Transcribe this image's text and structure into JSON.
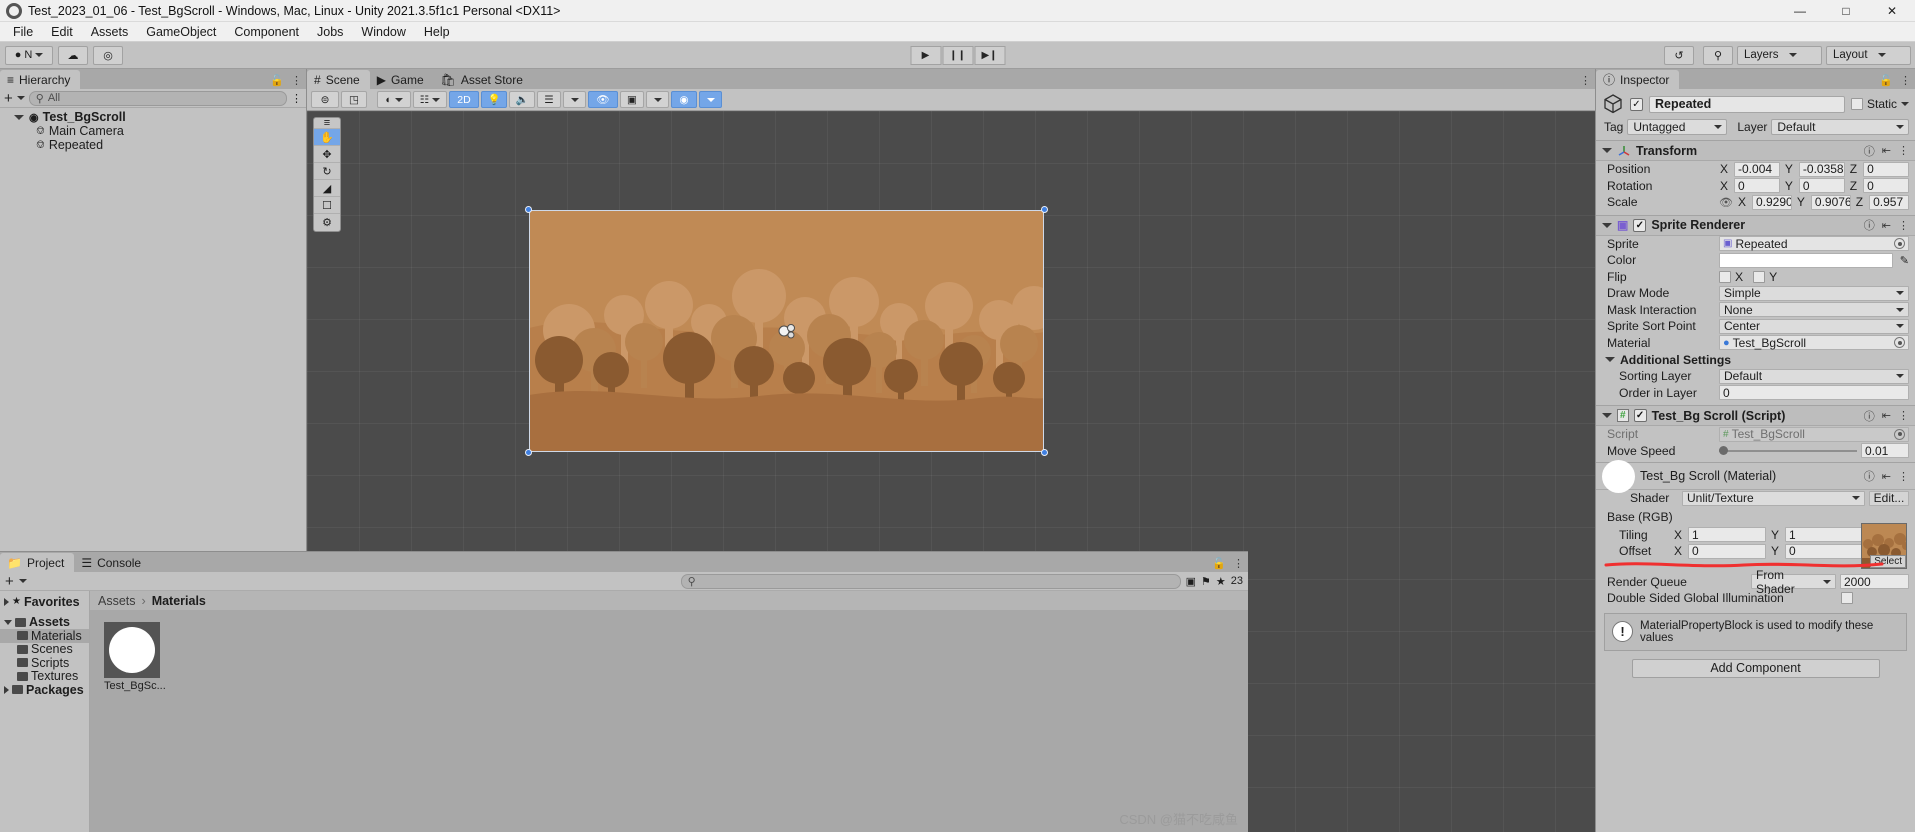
{
  "titlebar": {
    "title": "Test_2023_01_06 - Test_BgScroll - Windows, Mac, Linux - Unity 2021.3.5f1c1 Personal <DX11>",
    "minimize": "—",
    "maximize": "□",
    "close": "✕"
  },
  "menubar": {
    "items": [
      "File",
      "Edit",
      "Assets",
      "GameObject",
      "Component",
      "Jobs",
      "Window",
      "Help"
    ]
  },
  "toolbar": {
    "account": "N",
    "cloud": "☁",
    "services": "◎",
    "play": "▶",
    "pause": "❙❙",
    "step": "▶❙",
    "history": "↺",
    "search": "🔍",
    "layers_label": "Layers",
    "layout_label": "Layout"
  },
  "hierarchy": {
    "tab": "Hierarchy",
    "search_placeholder": "All",
    "items": [
      {
        "label": "Test_BgScroll",
        "level": 0,
        "icon": "unity-scene-icon"
      },
      {
        "label": "Main Camera",
        "level": 1,
        "icon": "gameobject-icon"
      },
      {
        "label": "Repeated",
        "level": 1,
        "icon": "gameobject-icon"
      }
    ]
  },
  "scene": {
    "tabs": [
      {
        "label": "Scene",
        "icon": "scene-icon",
        "active": true
      },
      {
        "label": "Game",
        "icon": "game-icon",
        "active": false
      },
      {
        "label": "Asset Store",
        "icon": "store-icon",
        "active": false
      }
    ],
    "toolbar": {
      "shading_mode": "Shaded",
      "twod_label": "2D",
      "buttons": [
        "pivot-icon",
        "local-icon",
        "shading-dropdown",
        "2d-toggle",
        "lighting-toggle",
        "audio-toggle",
        "fx-dropdown",
        "hidden-toggle",
        "camera-dropdown",
        "gizmos-dropdown"
      ]
    },
    "tools": [
      "hand-tool",
      "move-tool",
      "rotate-tool",
      "scale-tool",
      "rect-tool",
      "transform-tool"
    ],
    "active_tool": "hand-tool"
  },
  "inspector": {
    "tab": "Inspector",
    "gameobject": {
      "name": "Repeated",
      "enabled": true,
      "static_label": "Static",
      "tag_label": "Tag",
      "tag_value": "Untagged",
      "layer_label": "Layer",
      "layer_value": "Default"
    },
    "transform": {
      "title": "Transform",
      "rows": [
        {
          "label": "Position",
          "x": "-0.004",
          "y": "-0.0358",
          "z": "0"
        },
        {
          "label": "Rotation",
          "x": "0",
          "y": "0",
          "z": "0"
        },
        {
          "label": "Scale",
          "x": "0.929060",
          "y": "0.907618",
          "z": "0.957"
        }
      ]
    },
    "sprite_renderer": {
      "title": "Sprite Renderer",
      "enabled": true,
      "sprite_label": "Sprite",
      "sprite_value": "Repeated",
      "color_label": "Color",
      "color_value": "#FFFFFF",
      "flip_label": "Flip",
      "flip_x": "X",
      "flip_y": "Y",
      "draw_mode_label": "Draw Mode",
      "draw_mode_value": "Simple",
      "mask_label": "Mask Interaction",
      "mask_value": "None",
      "sort_point_label": "Sprite Sort Point",
      "sort_point_value": "Center",
      "material_label": "Material",
      "material_value": "Test_BgScroll",
      "additional_label": "Additional Settings",
      "sorting_layer_label": "Sorting Layer",
      "sorting_layer_value": "Default",
      "order_label": "Order in Layer",
      "order_value": "0"
    },
    "script_component": {
      "title": "Test_Bg Scroll (Script)",
      "enabled": true,
      "script_label": "Script",
      "script_value": "Test_BgScroll",
      "speed_label": "Move Speed",
      "speed_value": "0.01"
    },
    "material": {
      "title": "Test_Bg Scroll (Material)",
      "shader_label": "Shader",
      "shader_value": "Unlit/Texture",
      "edit_label": "Edit...",
      "base_label": "Base (RGB)",
      "tiling_label": "Tiling",
      "tiling_x": "1",
      "tiling_y": "1",
      "offset_label": "Offset",
      "offset_x": "0",
      "offset_y": "0",
      "select_label": "Select",
      "render_queue_label": "Render Queue",
      "render_queue_mode": "From Shader",
      "render_queue_value": "2000",
      "dsgi_label": "Double Sided Global Illumination",
      "helpbox": "MaterialPropertyBlock is used to modify these values"
    },
    "add_component": "Add Component",
    "annotation_color": "#f03030"
  },
  "project": {
    "tabs": [
      {
        "label": "Project",
        "icon": "folder-icon",
        "active": true
      },
      {
        "label": "Console",
        "icon": "console-icon",
        "active": false
      }
    ],
    "search_placeholder": "",
    "count_badge": "23",
    "tree": [
      {
        "label": "Favorites",
        "type": "favorites",
        "level": 0,
        "expanded": false
      },
      {
        "label": "Assets",
        "type": "root",
        "level": 0,
        "expanded": true
      },
      {
        "label": "Materials",
        "type": "folder",
        "level": 1,
        "selected": true
      },
      {
        "label": "Scenes",
        "type": "folder",
        "level": 1,
        "selected": false
      },
      {
        "label": "Scripts",
        "type": "folder",
        "level": 1,
        "selected": false
      },
      {
        "label": "Textures",
        "type": "folder",
        "level": 1,
        "selected": false
      },
      {
        "label": "Packages",
        "type": "root",
        "level": 0,
        "expanded": false
      }
    ],
    "breadcrumb": [
      "Assets",
      "Materials"
    ],
    "assets": [
      {
        "label": "Test_BgSc...",
        "icon": "material-ball-icon"
      }
    ]
  },
  "watermark": "CSDN @猫不吃咸鱼"
}
